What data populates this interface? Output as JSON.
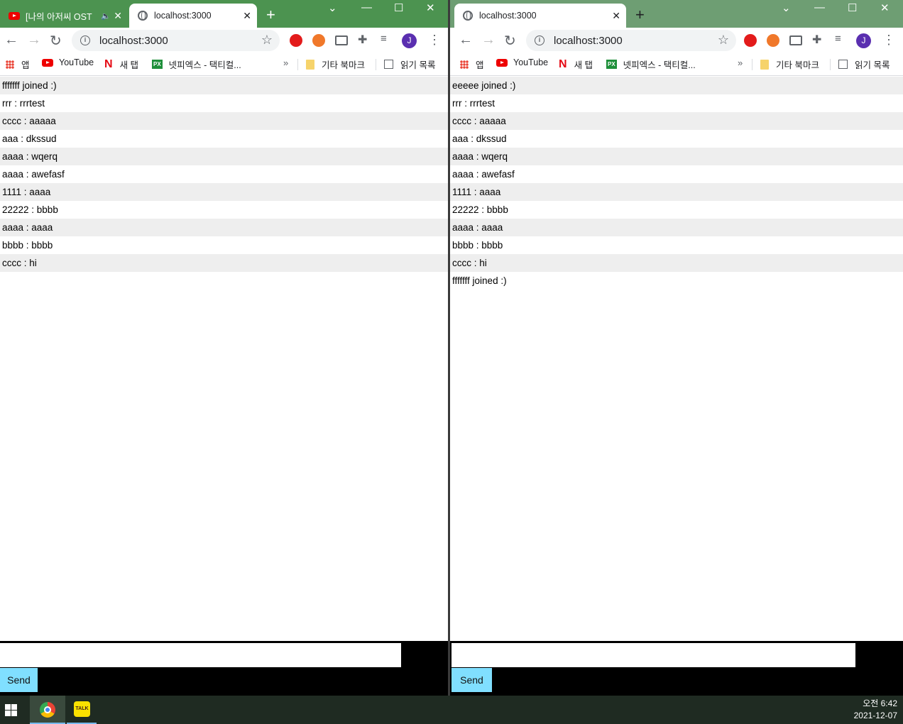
{
  "left_window": {
    "tabs": [
      {
        "title": "[나의 아저씨 OST",
        "favicon": "youtube-icon",
        "audio": true,
        "active": false
      },
      {
        "title": "localhost:3000",
        "favicon": "globe-icon",
        "active": true
      }
    ],
    "url": "localhost:3000",
    "messages": [
      "fffffff joined :)",
      "rrr : rrrtest",
      "cccc : aaaaa",
      "aaa : dkssud",
      "aaaa : wqerq",
      "aaaa : awefasf",
      "1111 : aaaa",
      "22222 : bbbb",
      "aaaa : aaaa",
      "bbbb : bbbb",
      "cccc : hi"
    ],
    "input_value": "",
    "send_label": "Send"
  },
  "right_window": {
    "tabs": [
      {
        "title": "localhost:3000",
        "favicon": "globe-icon",
        "active": true
      }
    ],
    "url": "localhost:3000",
    "messages": [
      "eeeee joined :)",
      "rrr : rrrtest",
      "cccc : aaaaa",
      "aaa : dkssud",
      "aaaa : wqerq",
      "aaaa : awefasf",
      "1111 : aaaa",
      "22222 : bbbb",
      "aaaa : aaaa",
      "bbbb : bbbb",
      "cccc : hi",
      "fffffff joined :)"
    ],
    "input_value": "",
    "send_label": "Send"
  },
  "bookmarks": {
    "apps": "앱",
    "youtube": "YouTube",
    "newtab": "새 탭",
    "netflix_icon": "N",
    "px_icon": "PX",
    "netpix": "넷피엑스 - 택티컬...",
    "more": "»",
    "other": "기타 북마크",
    "reading": "읽기 목록"
  },
  "profile_initial": "J",
  "taskbar": {
    "kakao_label": "TALK",
    "time": "오전 6:42",
    "date": "2021-12-07"
  },
  "colors": {
    "titlebar_left": "#4c9350",
    "titlebar_right": "#6e9e73",
    "send_button": "#80dfff",
    "stripe": "#eeeeee"
  }
}
